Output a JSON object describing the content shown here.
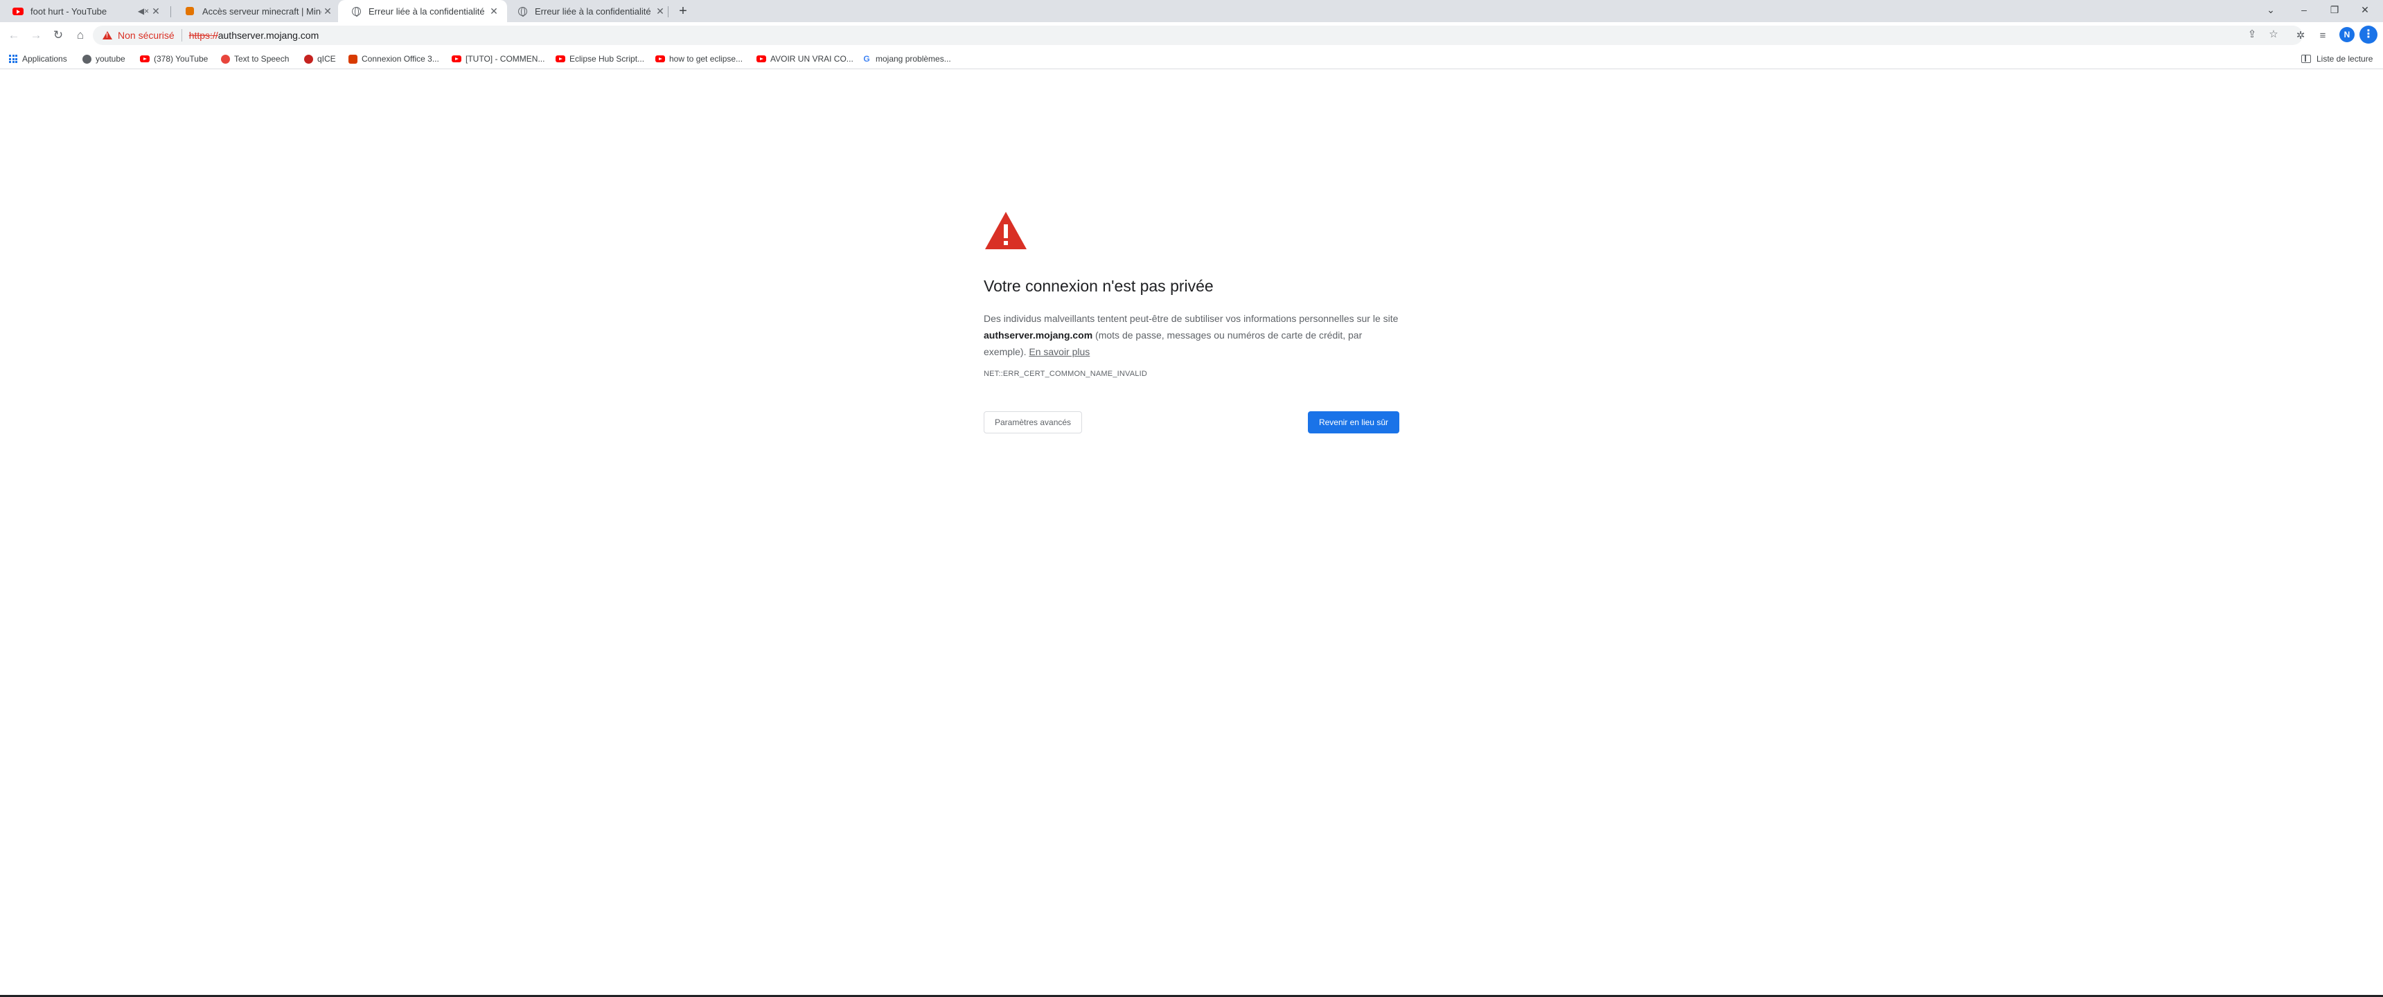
{
  "tabs": [
    {
      "title": "foot hurt - YouTube",
      "icon": "youtube-icon",
      "muted": true
    },
    {
      "title": "Accès serveur minecraft | Minecraft",
      "icon": "site-icon"
    },
    {
      "title": "Erreur liée à la confidentialité",
      "icon": "globe-icon",
      "active": true
    },
    {
      "title": "Erreur liée à la confidentialité",
      "icon": "globe-icon"
    }
  ],
  "toolbar": {
    "security_label": "Non sécurisé",
    "url_scheme": "https://",
    "url_host": "authserver.mojang.com",
    "avatar_letter": "N"
  },
  "bookmarks": [
    {
      "label": "Applications",
      "icon": "apps-grid-icon"
    },
    {
      "label": "youtube",
      "icon": "site-icon"
    },
    {
      "label": "(378) YouTube",
      "icon": "youtube-icon"
    },
    {
      "label": "Text to Speech",
      "icon": "site-icon"
    },
    {
      "label": "qICE",
      "icon": "site-icon"
    },
    {
      "label": "Connexion Office 3...",
      "icon": "office-icon"
    },
    {
      "label": "[TUTO] - COMMEN...",
      "icon": "youtube-icon"
    },
    {
      "label": "Eclipse Hub Script...",
      "icon": "youtube-icon"
    },
    {
      "label": "how to get eclipse...",
      "icon": "youtube-icon"
    },
    {
      "label": "AVOIR UN VRAI CO...",
      "icon": "youtube-icon"
    },
    {
      "label": "mojang problèmes...",
      "icon": "google-icon"
    }
  ],
  "reading_list_label": "Liste de lecture",
  "page": {
    "heading": "Votre connexion n'est pas privée",
    "desc_part1": "Des individus malveillants tentent peut-être de subtiliser vos informations personnelles sur le site ",
    "desc_host": "authserver.mojang.com",
    "desc_part2": " (mots de passe, messages ou numéros de carte de crédit, par exemple). ",
    "learn_more": "En savoir plus",
    "error_code": "NET::ERR_CERT_COMMON_NAME_INVALID",
    "advanced_button": "Paramètres avancés",
    "back_button": "Revenir en lieu sûr"
  },
  "colors": {
    "accent": "#1a73e8",
    "warning": "#d93025"
  }
}
